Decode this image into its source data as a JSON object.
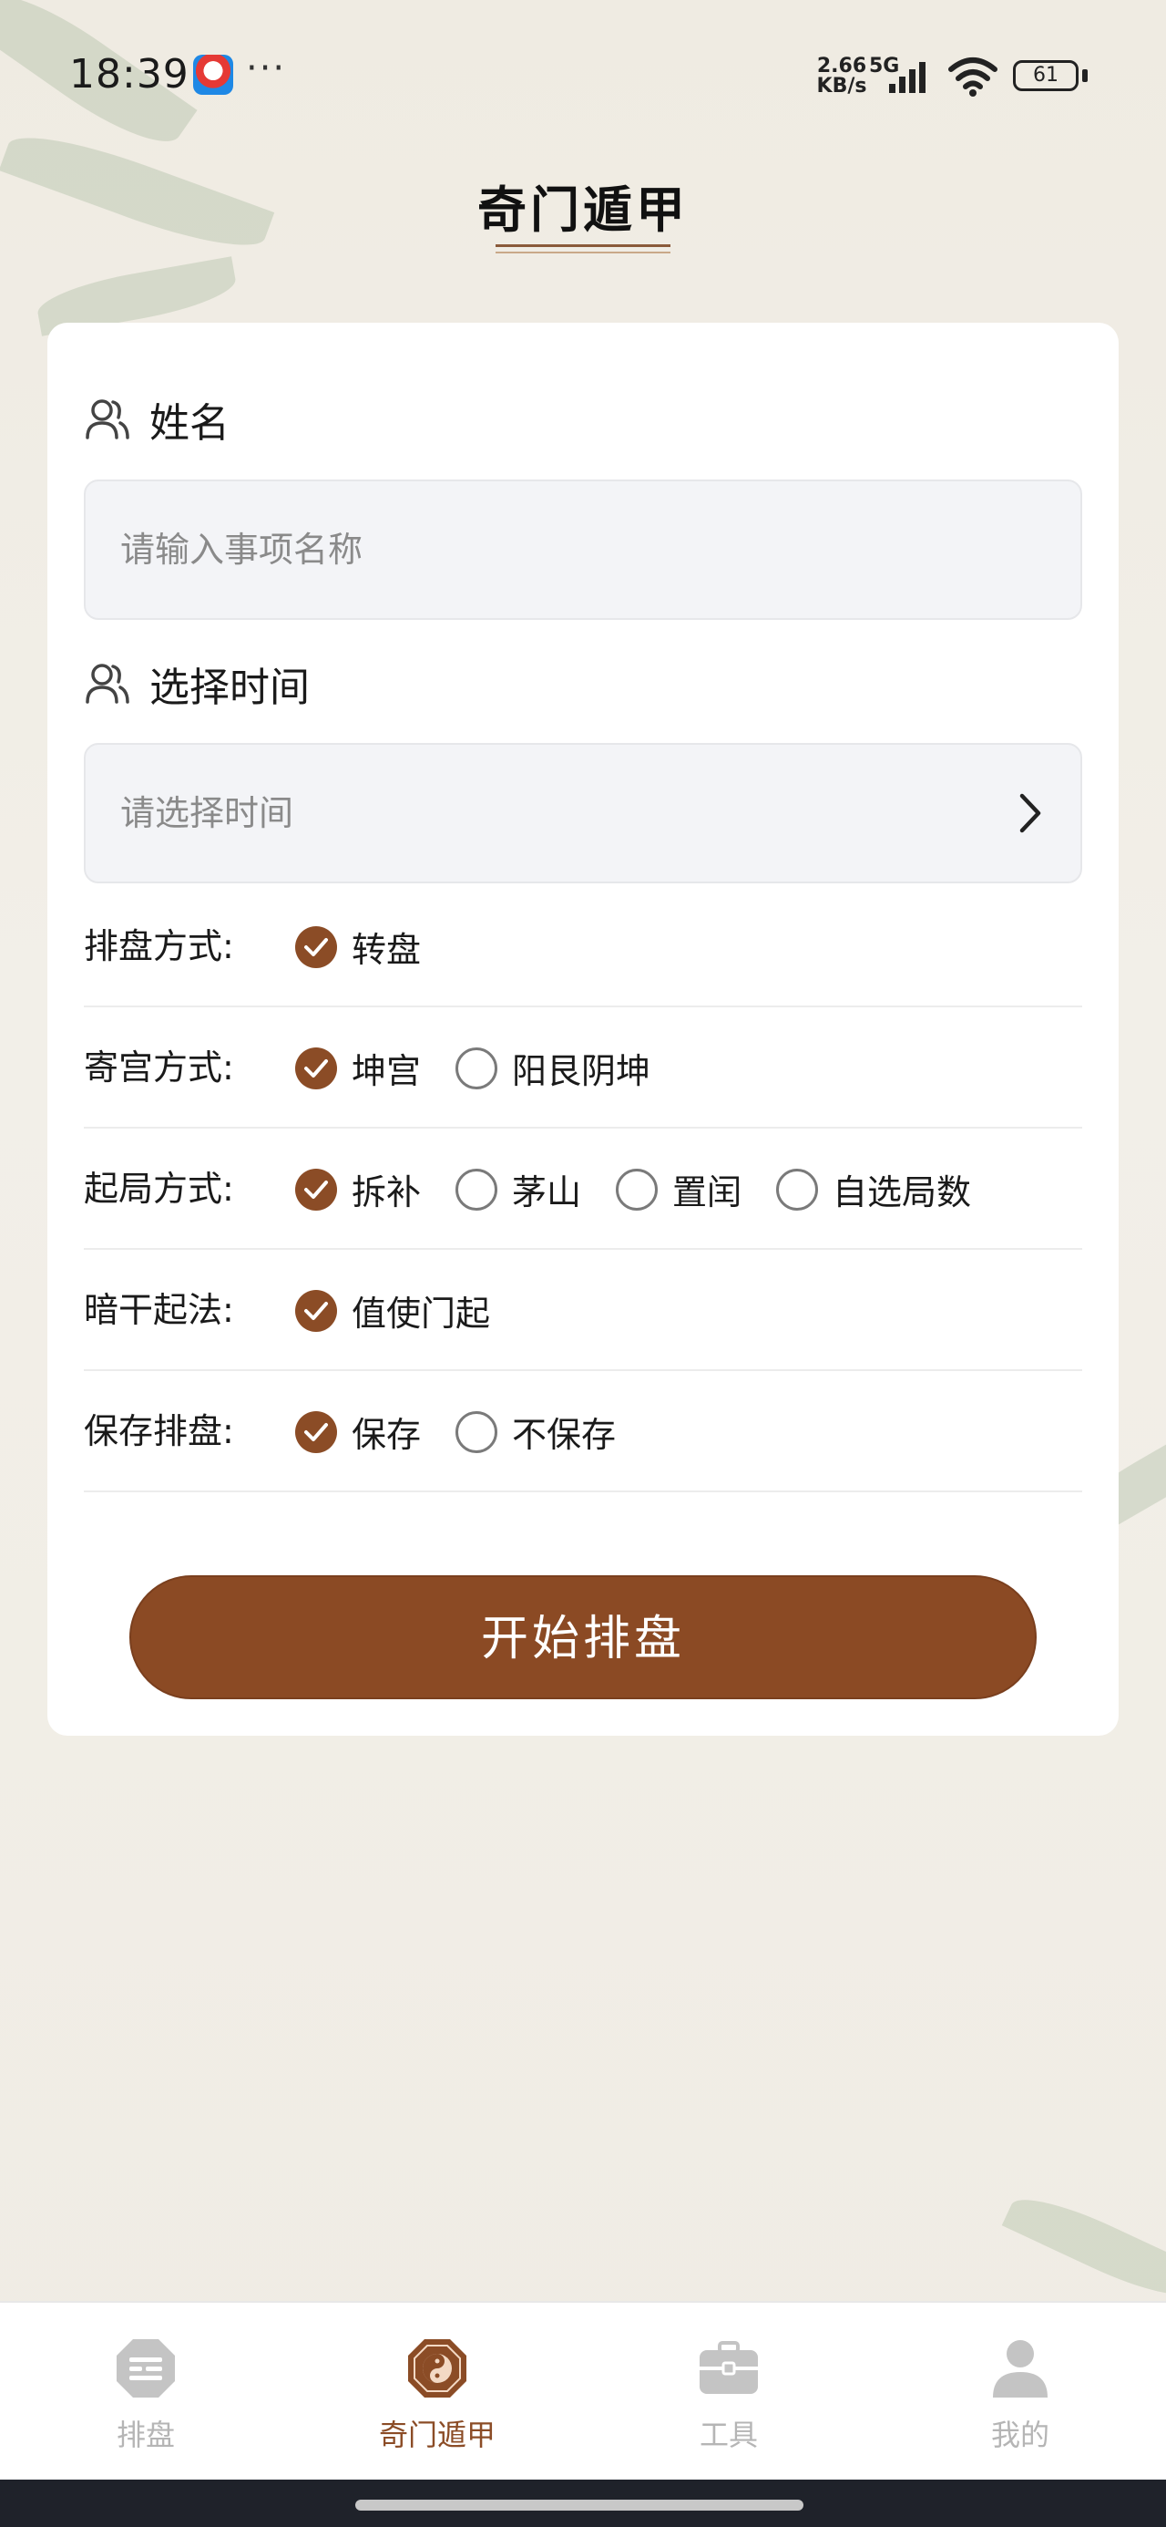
{
  "status_bar": {
    "time": "18:39",
    "dots": "···",
    "net_speed_value": "2.66",
    "net_speed_unit": "KB/s",
    "network": "5G",
    "battery": "61"
  },
  "header": {
    "title": "奇门遁甲"
  },
  "form": {
    "name_label": "姓名",
    "name_placeholder": "请输入事项名称",
    "time_label": "选择时间",
    "time_placeholder": "请选择时间",
    "rows": [
      {
        "label": "排盘方式:",
        "options": [
          {
            "label": "转盘",
            "checked": true
          }
        ]
      },
      {
        "label": "寄宫方式:",
        "options": [
          {
            "label": "坤宫",
            "checked": true
          },
          {
            "label": "阳艮阴坤",
            "checked": false
          }
        ]
      },
      {
        "label": "起局方式:",
        "options": [
          {
            "label": "拆补",
            "checked": true
          },
          {
            "label": "茅山",
            "checked": false
          },
          {
            "label": "置闰",
            "checked": false
          },
          {
            "label": "自选局数",
            "checked": false
          }
        ]
      },
      {
        "label": "暗干起法:",
        "options": [
          {
            "label": "值使门起",
            "checked": true
          }
        ]
      },
      {
        "label": "保存排盘:",
        "options": [
          {
            "label": "保存",
            "checked": true
          },
          {
            "label": "不保存",
            "checked": false
          }
        ]
      }
    ],
    "submit_label": "开始排盘"
  },
  "tabbar": {
    "tabs": [
      {
        "label": "排盘",
        "icon": "chart-icon",
        "active": false
      },
      {
        "label": "奇门遁甲",
        "icon": "bagua-icon",
        "active": true
      },
      {
        "label": "工具",
        "icon": "briefcase-icon",
        "active": false
      },
      {
        "label": "我的",
        "icon": "person-icon",
        "active": false
      }
    ]
  },
  "colors": {
    "accent": "#8b4c26",
    "inactive": "#b5b5b5",
    "background": "#f1eee6"
  }
}
